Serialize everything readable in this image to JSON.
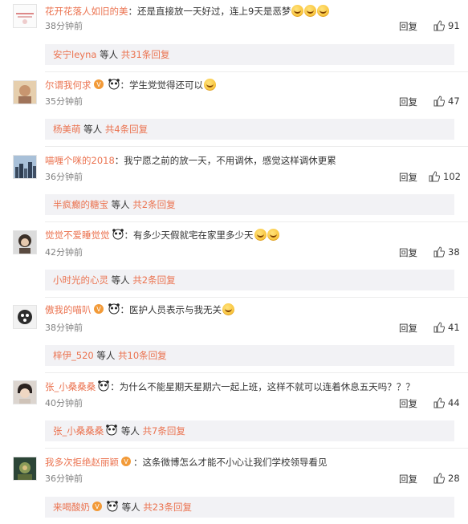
{
  "comments": [
    {
      "user": "花开花落人如旧的美",
      "text": "还是直接放一天好过，连上9天是恶梦",
      "time": "38分钟前",
      "likes": "91",
      "reply_user": "安宁leyna",
      "reply_mid": "等人",
      "reply_count": "共31条回复"
    },
    {
      "user": "尔谓我何求",
      "text": "学生党觉得还可以",
      "time": "35分钟前",
      "likes": "47",
      "reply_user": "杨美萌",
      "reply_mid": "等人",
      "reply_count": "共4条回复"
    },
    {
      "user": "喵喱个咪的2018",
      "text": "我宁愿之前的放一天，不用调休，感觉这样调休更累",
      "time": "36分钟前",
      "likes": "102",
      "reply_user": "半疯癫的糖宝",
      "reply_mid": "等人",
      "reply_count": "共2条回复"
    },
    {
      "user": "觉觉不爱睡觉觉",
      "text": "有多少天假就宅在家里多少天",
      "time": "42分钟前",
      "likes": "38",
      "reply_user": "小时光的心灵",
      "reply_mid": "等人",
      "reply_count": "共2条回复"
    },
    {
      "user": "傲我的喵叭",
      "text": "医护人员表示与我无关",
      "time": "38分钟前",
      "likes": "41",
      "reply_user": "梓伊_520",
      "reply_mid": "等人",
      "reply_count": "共10条回复"
    },
    {
      "user": "张_小桑桑桑",
      "text": "为什么不能星期天星期六一起上班，这样不就可以连着休息五天吗？？？",
      "time": "40分钟前",
      "likes": "44",
      "reply_user": "张_小桑桑桑",
      "reply_mid": "等人",
      "reply_count": "共7条回复"
    },
    {
      "user": "我多次拒绝赵丽颖",
      "text": "这条微博怎么才能不小心让我们学校领导看见",
      "time": "36分钟前",
      "likes": "28",
      "reply_user": "来喝酸奶",
      "reply_mid": "等人",
      "reply_count": "共23条回复"
    }
  ],
  "labels": {
    "reply": "回复",
    "colon": "："
  },
  "colors": {
    "username": "#eb7350",
    "reply_box_bg": "#f2f2f5",
    "time": "#808080"
  }
}
